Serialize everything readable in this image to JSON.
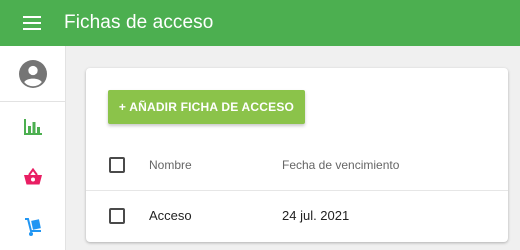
{
  "app_bar": {
    "title": "Fichas de acceso",
    "menu_icon": "hamburger-menu-icon",
    "color": "#4caf50"
  },
  "sidebar": {
    "avatar_icon": "account-circle-icon",
    "items": [
      {
        "icon": "bar-chart-icon",
        "color": "#4caf50"
      },
      {
        "icon": "shopping-basket-icon",
        "color": "#e91e63"
      },
      {
        "icon": "hand-truck-icon",
        "color": "#2196f3"
      }
    ]
  },
  "card": {
    "add_button_label": "+ AÑADIR FICHA DE ACCESO",
    "add_button_color": "#8bc34a",
    "table": {
      "headers": {
        "name": "Nombre",
        "expiry": "Fecha de vencimiento"
      },
      "rows": [
        {
          "name": "Acceso",
          "expiry": "24 jul. 2021"
        }
      ]
    }
  }
}
